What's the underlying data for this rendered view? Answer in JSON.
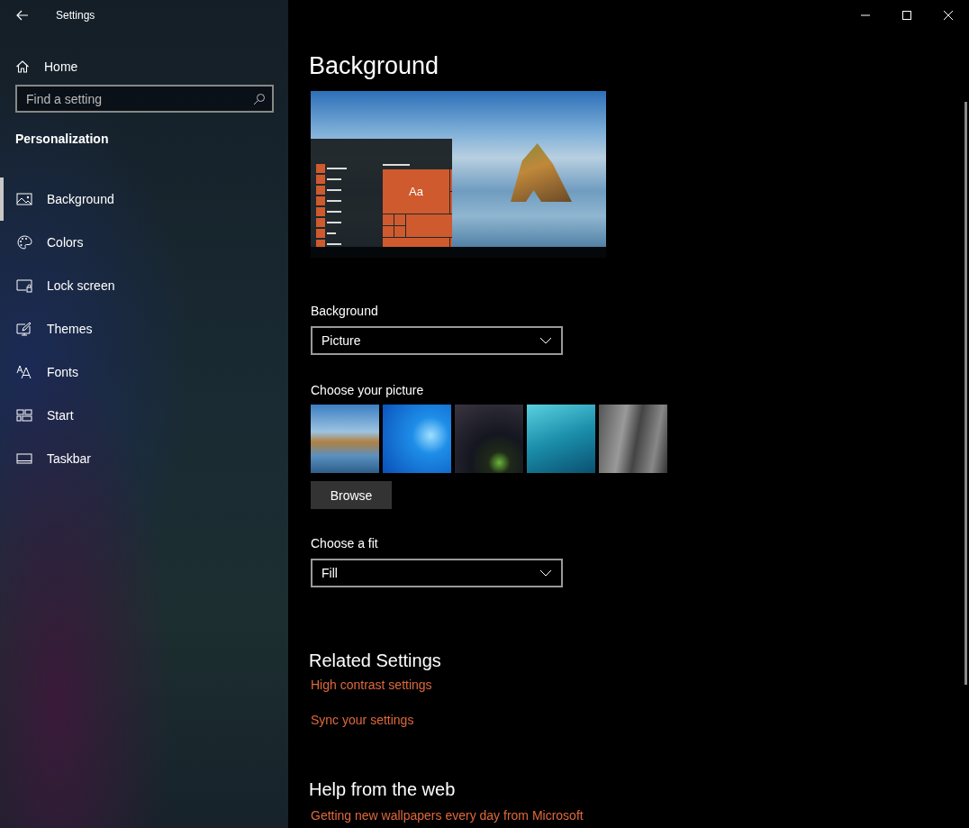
{
  "window": {
    "title": "Settings"
  },
  "sidebar": {
    "home": "Home",
    "search": {
      "placeholder": "Find a setting"
    },
    "section": "Personalization",
    "items": [
      {
        "label": "Background",
        "selected": true
      },
      {
        "label": "Colors",
        "selected": false
      },
      {
        "label": "Lock screen",
        "selected": false
      },
      {
        "label": "Themes",
        "selected": false
      },
      {
        "label": "Fonts",
        "selected": false
      },
      {
        "label": "Start",
        "selected": false
      },
      {
        "label": "Taskbar",
        "selected": false
      }
    ]
  },
  "page": {
    "title": "Background",
    "preview": {
      "tile_text": "Aa"
    },
    "background": {
      "label": "Background",
      "value": "Picture"
    },
    "pictures": {
      "label": "Choose your picture",
      "browse": "Browse"
    },
    "fit": {
      "label": "Choose a fit",
      "value": "Fill"
    },
    "related": {
      "title": "Related Settings",
      "links": [
        "High contrast settings",
        "Sync your settings"
      ]
    },
    "help": {
      "title": "Help from the web",
      "links": [
        "Getting new wallpapers every day from Microsoft"
      ]
    }
  }
}
